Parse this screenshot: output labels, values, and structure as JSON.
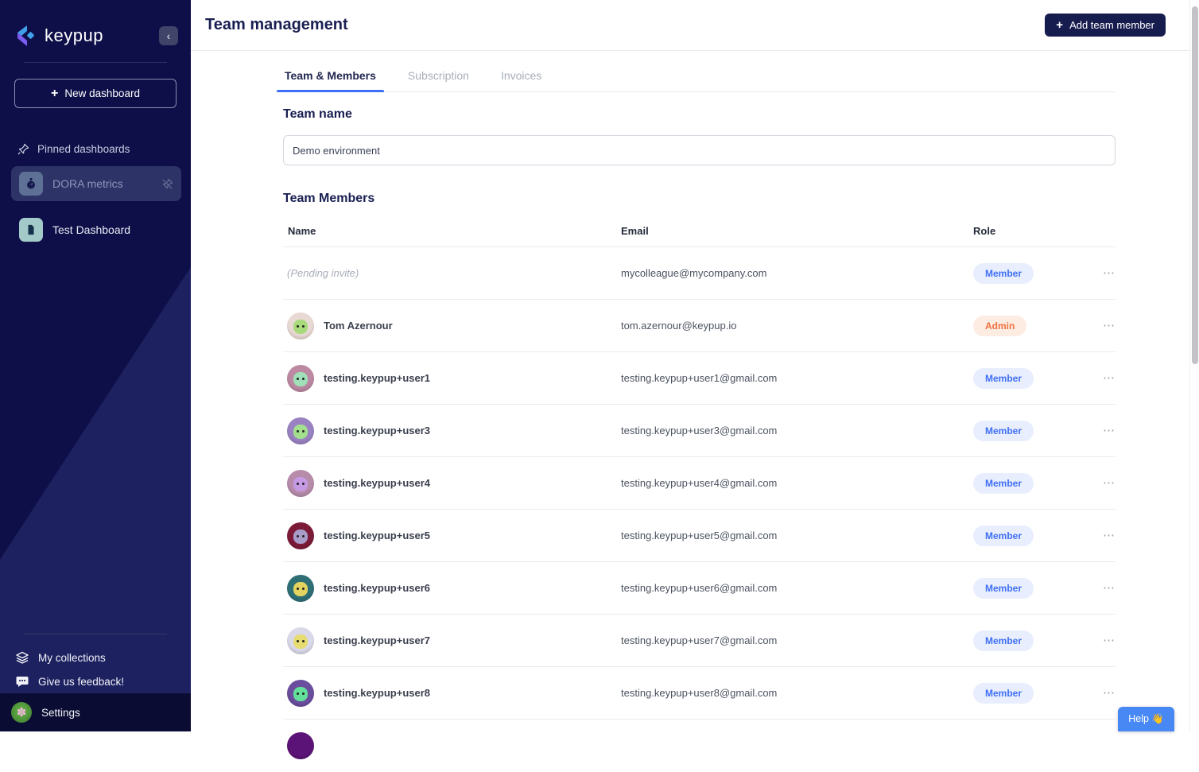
{
  "brand": {
    "name": "keypup"
  },
  "sidebar": {
    "collapse_icon": "chevron-left",
    "new_dashboard_label": "New dashboard",
    "pinned_section_label": "Pinned dashboards",
    "pinned_items": [
      {
        "label": "DORA metrics",
        "icon": "stopwatch-icon",
        "selected": true,
        "icon_bg": "#5e7095"
      },
      {
        "label": "Test Dashboard",
        "icon": "document-icon",
        "selected": false,
        "icon_bg": "#a3c9c9"
      }
    ],
    "footer_items": [
      {
        "label": "My collections",
        "icon": "layers-icon"
      },
      {
        "label": "Give us feedback!",
        "icon": "feedback-icon"
      }
    ],
    "settings_label": "Settings"
  },
  "header": {
    "title": "Team management",
    "add_button_label": "Add team member"
  },
  "tabs": [
    {
      "label": "Team & Members",
      "active": true
    },
    {
      "label": "Subscription",
      "active": false
    },
    {
      "label": "Invoices",
      "active": false
    }
  ],
  "team_name": {
    "heading": "Team name",
    "value": "Demo environment"
  },
  "members": {
    "heading": "Team Members",
    "columns": [
      "Name",
      "Email",
      "Role"
    ],
    "rows": [
      {
        "name": "(Pending invite)",
        "pending": true,
        "email": "mycolleague@mycompany.com",
        "role": "Member"
      },
      {
        "name": "Tom Azernour",
        "email": "tom.azernour@keypup.io",
        "role": "Admin",
        "avatar": {
          "ring": "#e9d9d4",
          "face": "#a8d97a"
        }
      },
      {
        "name": "testing.keypup+user1",
        "email": "testing.keypup+user1@gmail.com",
        "role": "Member",
        "avatar": {
          "ring": "#bc88a2",
          "face": "#9fe0b8"
        }
      },
      {
        "name": "testing.keypup+user3",
        "email": "testing.keypup+user3@gmail.com",
        "role": "Member",
        "avatar": {
          "ring": "#9a82c2",
          "face": "#a2e08e"
        }
      },
      {
        "name": "testing.keypup+user4",
        "email": "testing.keypup+user4@gmail.com",
        "role": "Member",
        "avatar": {
          "ring": "#b78cab",
          "face": "#c79ae6"
        }
      },
      {
        "name": "testing.keypup+user5",
        "email": "testing.keypup+user5@gmail.com",
        "role": "Member",
        "avatar": {
          "ring": "#7c1b38",
          "face": "#aa9cc8"
        }
      },
      {
        "name": "testing.keypup+user6",
        "email": "testing.keypup+user6@gmail.com",
        "role": "Member",
        "avatar": {
          "ring": "#2e6f76",
          "face": "#e3d45f"
        }
      },
      {
        "name": "testing.keypup+user7",
        "email": "testing.keypup+user7@gmail.com",
        "role": "Member",
        "avatar": {
          "ring": "#d9d9e9",
          "face": "#e6dc72"
        }
      },
      {
        "name": "testing.keypup+user8",
        "email": "testing.keypup+user8@gmail.com",
        "role": "Member",
        "avatar": {
          "ring": "#6b4d9e",
          "face": "#63e09a"
        }
      },
      {
        "name": "",
        "email": "",
        "role": "",
        "partial": true,
        "avatar": {
          "ring": "#5c1377",
          "face": "#5c1377"
        }
      }
    ]
  },
  "help": {
    "label": "Help 👋"
  },
  "colors": {
    "sidebar_bg": "#0e0f48",
    "sidebar_triangle": "#1d2160",
    "accent_blue": "#3f6ff5",
    "primary_navy": "#171c4e",
    "member_badge_bg": "#e8eefd",
    "member_badge_text": "#3f6ff5",
    "admin_badge_bg": "#fdece2",
    "admin_badge_text": "#ef7140",
    "help_button": "#4788f4"
  }
}
